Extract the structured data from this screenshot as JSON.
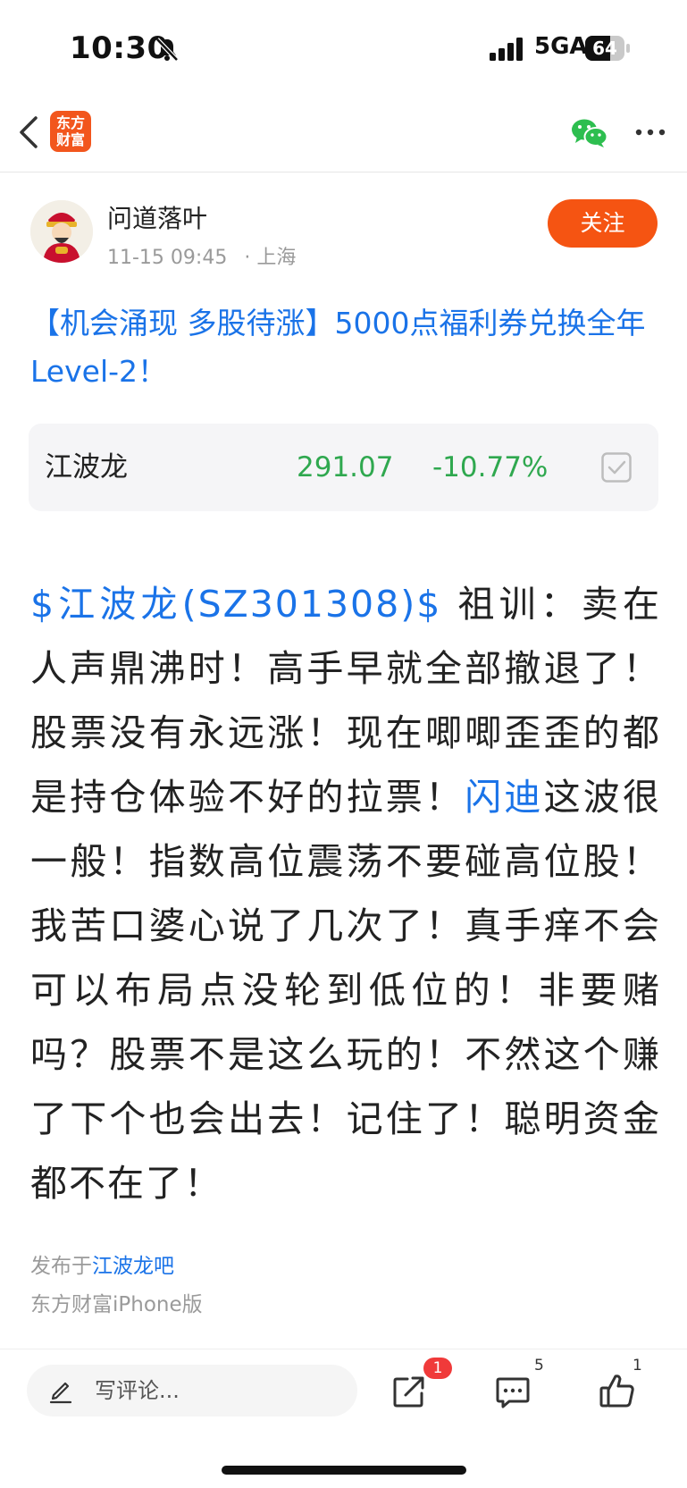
{
  "status_bar": {
    "time": "10:30",
    "network": "5GA",
    "battery": "64",
    "battery_level": 0.64
  },
  "nav": {
    "back_icon": "chevron-left-icon",
    "logo_line1": "东方",
    "logo_line2": "财富",
    "share_icon": "wechat-icon",
    "more_icon": "more-dots-icon"
  },
  "post": {
    "author": "问道落叶",
    "timestamp": "11-15 09:45",
    "location": "· 上海",
    "follow_label": "关注",
    "promo_title": "【机会涌现 多股待涨】5000点福利券兑换全年Level-2！",
    "stock_card": {
      "name": "江波龙",
      "price": "291.07",
      "change": "-10.77%"
    },
    "content": {
      "stock_tag": "$江波龙(SZ301308)$",
      "text1": " 祖训：卖在人声鼎沸时！高手早就全部撤退了！股票没有永远涨！现在唧唧歪歪的都是持仓体验不好的拉票！",
      "link2": "闪迪",
      "text2": "这波很一般！指数高位震荡不要碰高位股！我苦口婆心说了几次了！真手痒不会可以布局点没轮到低位的！非要赌吗？股票不是这么玩的！不然这个赚了下个也会出去！记住了！聪明资金都不在了！"
    },
    "published_prefix": "发布于",
    "published_bar": "江波龙吧",
    "client": "东方财富iPhone版"
  },
  "bottom_bar": {
    "comment_placeholder": "写评论...",
    "share_badge": "1",
    "comment_count": "5",
    "like_count": "1"
  },
  "colors": {
    "accent_orange": "#f55412",
    "link_blue": "#1a73e8",
    "down_green": "#2fa84f",
    "badge_red": "#f03a3a"
  }
}
